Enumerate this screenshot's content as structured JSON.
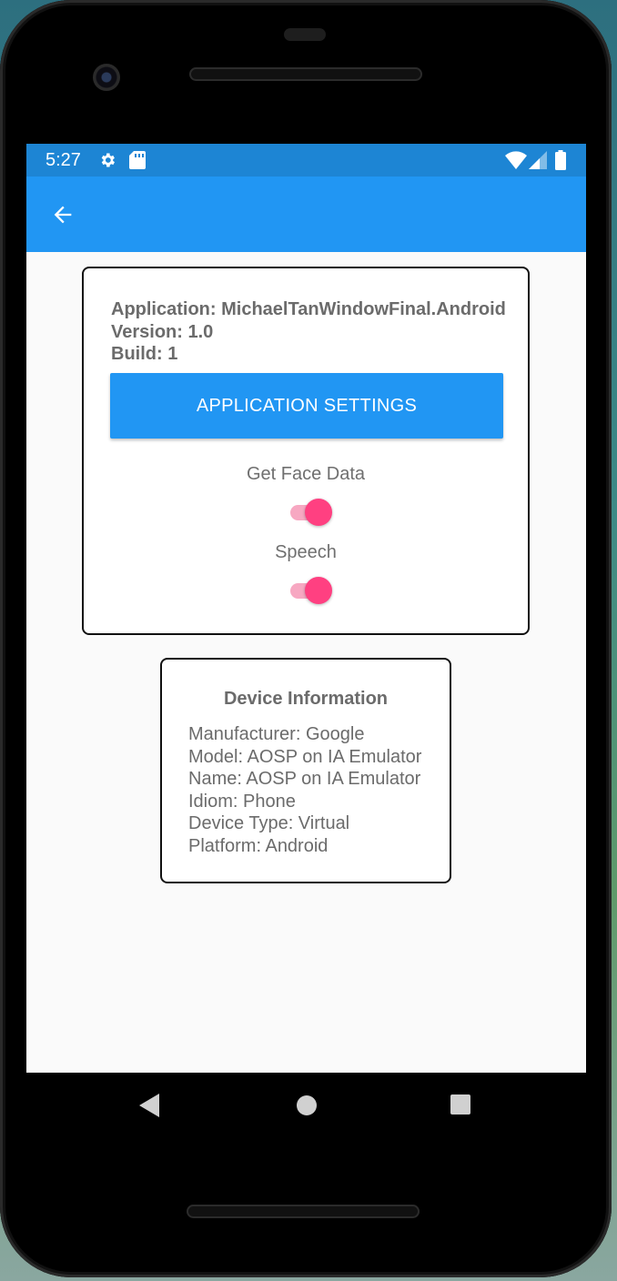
{
  "status_bar": {
    "time": "5:27",
    "icons": [
      "settings-icon",
      "sd-card-icon",
      "wifi-icon",
      "signal-icon",
      "battery-icon"
    ]
  },
  "app_bar": {
    "back_icon": "arrow-back-icon"
  },
  "app_card": {
    "application_line": "Application: MichaelTanWindowFinal.Android",
    "version_line": "Version: 1.0",
    "build_line": "Build: 1",
    "settings_button_label": "APPLICATION SETTINGS",
    "toggles": [
      {
        "label": "Get Face Data",
        "on": true
      },
      {
        "label": "Speech",
        "on": true
      }
    ]
  },
  "device_card": {
    "title": "Device Information",
    "lines": [
      "Manufacturer: Google",
      "Model: AOSP on IA Emulator",
      "Name: AOSP on IA Emulator",
      "Idiom: Phone",
      "Device Type: Virtual",
      "Platform: Android"
    ]
  },
  "nav_bar": {
    "icons": [
      "back-triangle-icon",
      "home-circle-icon",
      "recents-square-icon"
    ]
  },
  "colors": {
    "status_bar": "#1d85d4",
    "app_bar": "#2196f3",
    "accent": "#ff4081",
    "text_gray": "#6b6b6b"
  }
}
